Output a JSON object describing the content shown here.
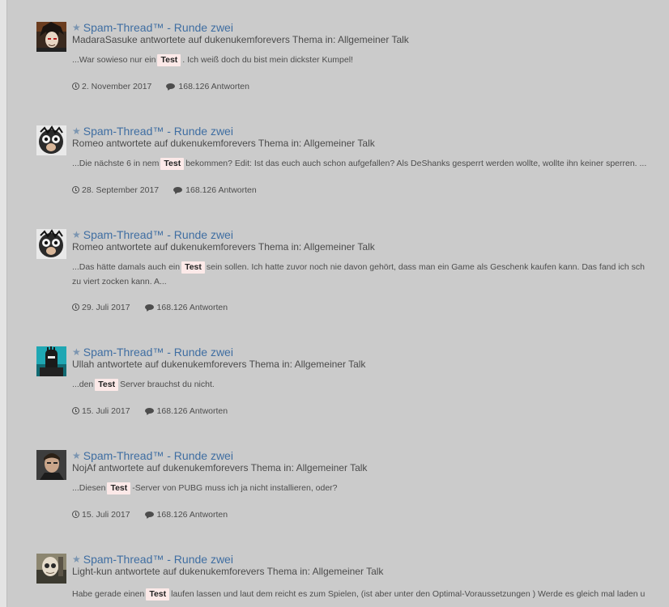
{
  "results": [
    {
      "title": "Spam-Thread™ - Runde zwei",
      "meta": "MadaraSasuke antwortete auf dukenukemforevers Thema in: Allgemeiner Talk",
      "snippet_before": "...War sowieso nur ein",
      "highlight": "Test",
      "snippet_after": ". Ich weiß doch du bist mein dickster Kumpel!",
      "date": "2. November 2017",
      "replies": "168.126 Antworten"
    },
    {
      "title": "Spam-Thread™ - Runde zwei",
      "meta": "Romeo antwortete auf dukenukemforevers Thema in: Allgemeiner Talk",
      "snippet_before": "...Die nächste 6 in nem",
      "highlight": "Test",
      "snippet_after": "bekommen? Edit: Ist das euch auch schon aufgefallen? Als DeShanks gesperrt werden wollte, wollte ihn keiner sperren. ...",
      "date": "28. September 2017",
      "replies": "168.126 Antworten"
    },
    {
      "title": "Spam-Thread™ - Runde zwei",
      "meta": "Romeo antwortete auf dukenukemforevers Thema in: Allgemeiner Talk",
      "snippet_before": "...Das hätte damals auch ein",
      "highlight": "Test",
      "snippet_after": "sein sollen. Ich hatte zuvor noch nie davon gehört, dass man ein Game als Geschenk kaufen kann. Das fand ich sch",
      "snippet_line2": "zu viert zocken kann. A...",
      "date": "29. Juli 2017",
      "replies": "168.126 Antworten"
    },
    {
      "title": "Spam-Thread™ - Runde zwei",
      "meta": "Ullah antwortete auf dukenukemforevers Thema in: Allgemeiner Talk",
      "snippet_before": "...den",
      "highlight": "Test",
      "snippet_after": "Server brauchst du nicht.",
      "date": "15. Juli 2017",
      "replies": "168.126 Antworten"
    },
    {
      "title": "Spam-Thread™ - Runde zwei",
      "meta": "NojAf antwortete auf dukenukemforevers Thema in: Allgemeiner Talk",
      "snippet_before": "...Diesen",
      "highlight": "Test",
      "snippet_after": "-Server von PUBG muss ich ja nicht installieren, oder?",
      "date": "15. Juli 2017",
      "replies": "168.126 Antworten"
    },
    {
      "title": "Spam-Thread™ - Runde zwei",
      "meta": "Light-kun antwortete auf dukenukemforevers Thema in: Allgemeiner Talk",
      "snippet_before": "Habe gerade einen",
      "highlight": "Test",
      "snippet_after": "laufen lassen und laut dem reicht es zum Spielen, (ist aber unter den Optimal-Voraussetzungen ) Werde es gleich mal laden u"
    }
  ]
}
